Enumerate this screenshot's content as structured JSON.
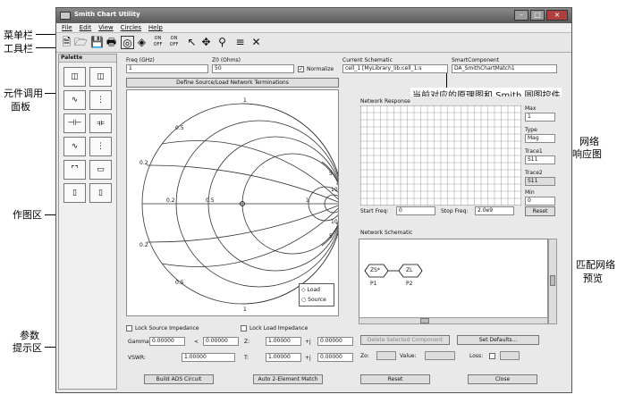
{
  "window": {
    "title": "Smith Chart Utility"
  },
  "menu": [
    "File",
    "Edit",
    "View",
    "Circles",
    "Help"
  ],
  "palette": {
    "title": "Palette"
  },
  "freq": {
    "label": "Freq (GHz)",
    "value": "1"
  },
  "z0": {
    "label": "Z0 (Ohms)",
    "value": "50"
  },
  "normalize": {
    "label": "Normalize",
    "checked": true
  },
  "define_button": "Define Source/Load Network Terminations",
  "current_schematic": {
    "label": "Current Schematic",
    "value": "cell_1 [MyLibrary_lib:cell_1:s"
  },
  "smart_component": {
    "label": "SmartComponent",
    "value": "DA_SmithChartMatch1"
  },
  "network_response": {
    "title": "Network Response",
    "start_label": "Start Freq:",
    "start_value": "0",
    "stop_label": "Stop Freq:",
    "stop_value": "2.0e9",
    "reset": "Reset"
  },
  "side_controls": {
    "max_label": "Max",
    "max_value": "1",
    "type_label": "Type",
    "type_value": "Mag",
    "trace1_label": "Trace1",
    "trace1_value": "S11",
    "trace2_label": "Trace2",
    "trace2_value": "S11",
    "min_label": "Min",
    "min_value": "0"
  },
  "network_schematic": {
    "title": "Network Schematic",
    "zs": "ZS*",
    "zl": "ZL",
    "p1": "P1",
    "p2": "P2"
  },
  "smith_labels": {
    "top": "1",
    "r05": "0.5",
    "left02": "0.2",
    "right5": "5",
    "right10": "10",
    "r02": "0.2",
    "r05b": "0.5",
    "r1": "1",
    "bl02": "0.2",
    "bl05": "0.5",
    "bottom1": "1",
    "br5": "5",
    "br10": "10"
  },
  "legend": {
    "load": "Load",
    "source": "Source"
  },
  "lock_source": "Lock Source Impedance",
  "lock_load": "Lock Load Impedance",
  "gamma": {
    "label": "Gamma:",
    "v1": "0.00000",
    "sep": "<",
    "v2": "0.00000"
  },
  "z_row": {
    "label": "Z:",
    "v1": "1.00000",
    "sep": "+j",
    "v2": "0.00000"
  },
  "vswr": {
    "label": "VSWR:",
    "value": "1.00000"
  },
  "t_row": {
    "label": "T:",
    "v1": "1.00000",
    "sep": "+j",
    "v2": "0.00000"
  },
  "delete_button": "Delete Selected Component",
  "set_defaults": "Set Defaults...",
  "zo_label": "Zo:",
  "value_label": "Value:",
  "loss_label": "Loss:",
  "bottom_buttons": {
    "build": "Build ADS Circuit",
    "auto": "Auto 2-Element Match",
    "reset": "Reset",
    "close": "Close"
  },
  "annotations": {
    "menubar": "菜单栏",
    "toolbar": "工具栏",
    "palette": "元件调用",
    "palette2": "面板",
    "schematic": "当前对应的原理图和 Smith 圆图控件",
    "response": "网络",
    "response2": "响应图",
    "plot": "作图区",
    "match": "匹配网络",
    "match2": "预览",
    "params": "参数",
    "params2": "提示区"
  }
}
